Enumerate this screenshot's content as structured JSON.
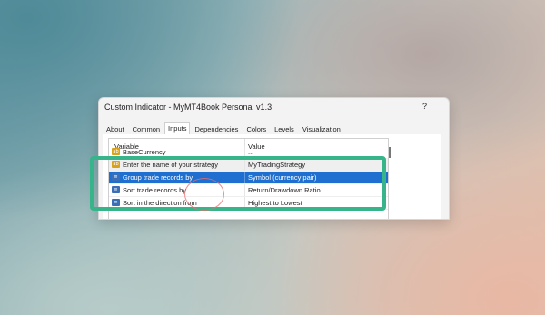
{
  "window": {
    "title": "Custom Indicator - MyMT4Book Personal v1.3",
    "help_label": "?"
  },
  "tabs": [
    {
      "label": "About",
      "active": false
    },
    {
      "label": "Common",
      "active": false
    },
    {
      "label": "Inputs",
      "active": true
    },
    {
      "label": "Dependencies",
      "active": false
    },
    {
      "label": "Colors",
      "active": false
    },
    {
      "label": "Levels",
      "active": false
    },
    {
      "label": "Visualization",
      "active": false
    }
  ],
  "grid": {
    "columns": [
      "Variable",
      "Value"
    ],
    "rows": [
      {
        "variable": "BaseCurrency",
        "value": "...",
        "icon": "abc-icon",
        "state": "partial"
      },
      {
        "variable": "Enter the name of your strategy",
        "value": "MyTradingStrategy",
        "icon": "abc-icon",
        "state": "gray"
      },
      {
        "variable": "Group trade records by",
        "value": "Symbol (currency pair)",
        "icon": "enum-icon",
        "state": "selected"
      },
      {
        "variable": "Sort trade records by",
        "value": "Return/Drawdown Ratio",
        "icon": "enum-icon",
        "state": "normal"
      },
      {
        "variable": "Sort in the direction from",
        "value": "Highest to Lowest",
        "icon": "enum-icon",
        "state": "partial"
      }
    ]
  },
  "colors": {
    "selection": "#1e6fd0",
    "highlight_frame": "#37b48a",
    "cursor_ring": "#eb6e6e",
    "string_icon": "#d9a21b",
    "enum_icon": "#3a6fb8"
  }
}
